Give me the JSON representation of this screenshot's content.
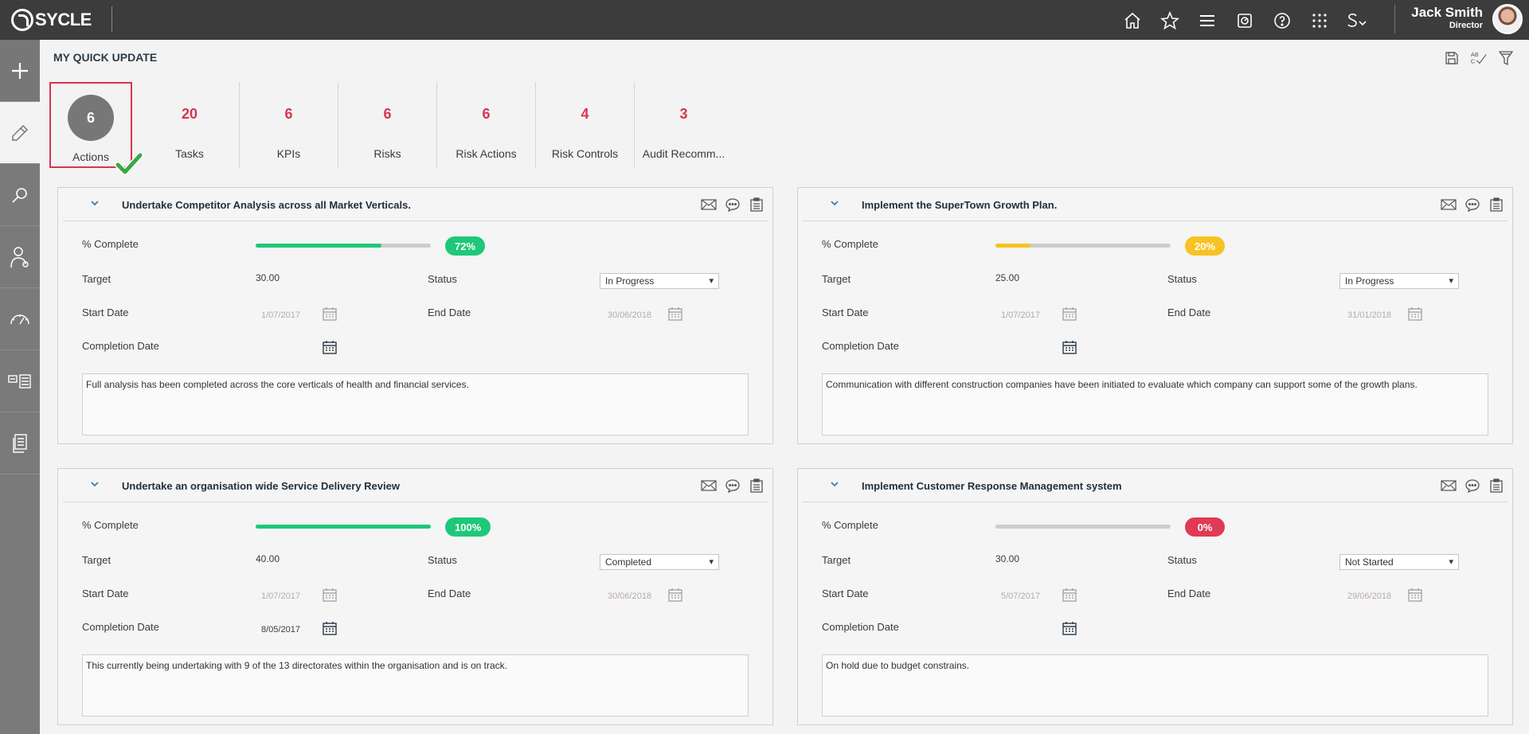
{
  "app": {
    "logo": "SYCLE"
  },
  "user": {
    "name": "Jack Smith",
    "role": "Director"
  },
  "page": {
    "title": "MY QUICK UPDATE"
  },
  "topnav": [
    "home-icon",
    "star-icon",
    "menu-icon",
    "dashboard-icon",
    "help-icon",
    "apps-grid-icon",
    "sv-icon"
  ],
  "sidebar": [
    "add-icon",
    "edit-icon",
    "search-icon",
    "people-icon",
    "gauge-icon",
    "list-icon",
    "document-icon"
  ],
  "tabs": [
    {
      "count": "6",
      "label": "Actions"
    },
    {
      "count": "20",
      "label": "Tasks"
    },
    {
      "count": "6",
      "label": "KPIs"
    },
    {
      "count": "6",
      "label": "Risks"
    },
    {
      "count": "6",
      "label": "Risk Actions"
    },
    {
      "count": "4",
      "label": "Risk Controls"
    },
    {
      "count": "3",
      "label": "Audit Recomm..."
    }
  ],
  "labels": {
    "pct_complete": "% Complete",
    "target": "Target",
    "status": "Status",
    "start_date": "Start Date",
    "end_date": "End Date",
    "completion_date": "Completion Date"
  },
  "cards": [
    {
      "title": "Undertake Competitor Analysis across all Market Verticals.",
      "percent": 72,
      "percent_label": "72%",
      "color": "#1ec878",
      "target": "30.00",
      "status": "In Progress",
      "start_date": "1/07/2017",
      "end_date": "30/06/2018",
      "completion_date": "",
      "comment": "Full analysis has been completed across the core verticals of health and financial services."
    },
    {
      "title": "Implement the SuperTown Growth Plan.",
      "percent": 20,
      "percent_label": "20%",
      "color": "#f6c322",
      "target": "25.00",
      "status": "In Progress",
      "start_date": "1/07/2017",
      "end_date": "31/01/2018",
      "completion_date": "",
      "comment": "Communication with different construction companies have been initiated to evaluate which company can support some of the growth plans."
    },
    {
      "title": "Undertake an organisation wide Service Delivery Review",
      "percent": 100,
      "percent_label": "100%",
      "color": "#1ec878",
      "target": "40.00",
      "status": "Completed",
      "start_date": "1/07/2017",
      "end_date": "30/06/2018",
      "completion_date": "8/05/2017",
      "comment": "This currently being undertaking with 9 of the 13 directorates within the organisation and is on track."
    },
    {
      "title": "Implement Customer Response Management system",
      "percent": 0,
      "percent_label": "0%",
      "color": "#e03a55",
      "target": "30.00",
      "status": "Not Started",
      "start_date": "5/07/2017",
      "end_date": "29/06/2018",
      "completion_date": "",
      "comment": "On hold due to budget constrains."
    }
  ]
}
